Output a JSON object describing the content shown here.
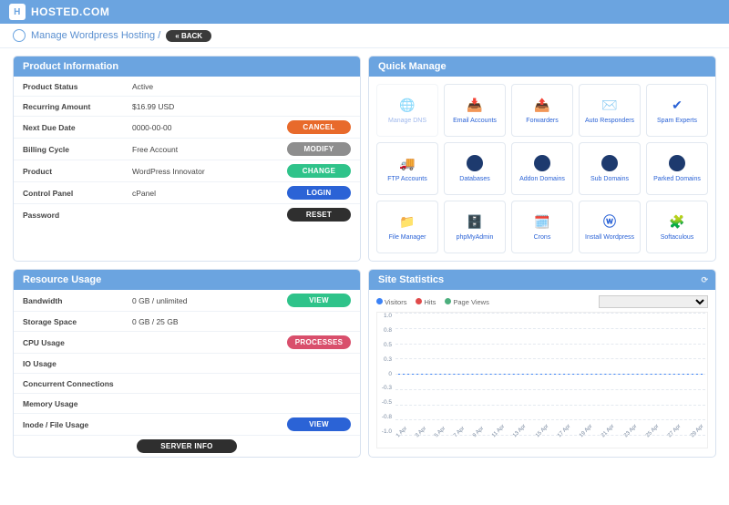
{
  "brand": "HOSTED.COM",
  "breadcrumb": "Manage Wordpress Hosting /",
  "back_label": "« BACK",
  "panels": {
    "product_info": {
      "title": "Product Information"
    },
    "quick_manage": {
      "title": "Quick Manage"
    },
    "resource_usage": {
      "title": "Resource Usage"
    },
    "site_stats": {
      "title": "Site Statistics"
    }
  },
  "rows": {
    "status_l": "Product Status",
    "status_v": "Active",
    "recur_l": "Recurring Amount",
    "recur_v": "$16.99 USD",
    "next_l": "Next Due Date",
    "next_v": "0000-00-00",
    "cycle_l": "Billing Cycle",
    "cycle_v": "Free Account",
    "product_l": "Product",
    "product_v": "WordPress Innovator",
    "cpanel_l": "Control Panel",
    "cpanel_v": "cPanel",
    "pass_l": "Password"
  },
  "btns": {
    "cancel": "CANCEL",
    "modify": "MODIFY",
    "change": "CHANGE",
    "login": "LOGIN",
    "reset": "RESET",
    "view": "VIEW",
    "processes": "PROCESSES",
    "server": "SERVER INFO"
  },
  "res": {
    "bw_l": "Bandwidth",
    "bw_v": "0 GB / unlimited",
    "sp_l": "Storage Space",
    "sp_v": "0 GB / 25 GB",
    "cpu_l": "CPU Usage",
    "io_l": "IO Usage",
    "cc_l": "Concurrent Connections",
    "mem_l": "Memory Usage",
    "inode_l": "Inode / File Usage"
  },
  "qm": {
    "dns": "Manage DNS",
    "email": "Email Accounts",
    "fwd": "Forwarders",
    "auto": "Auto Responders",
    "spam": "Spam Experts",
    "ftp": "FTP Accounts",
    "db": "Databases",
    "addon": "Addon Domains",
    "sub": "Sub Domains",
    "parked": "Parked Domains",
    "fm": "File Manager",
    "pma": "phpMyAdmin",
    "crons": "Crons",
    "wp": "Install Wordpress",
    "soft": "Softaculous"
  },
  "legend": {
    "visitors": "Visitors",
    "hits": "Hits",
    "pv": "Page Views"
  },
  "chart_data": {
    "type": "line",
    "title": "",
    "xlabel": "",
    "ylabel": "",
    "ylim": [
      -1.0,
      1.0
    ],
    "yticks": [
      "1.0",
      "0.8",
      "0.5",
      "0.3",
      "0",
      "-0.3",
      "-0.5",
      "-0.8",
      "-1.0"
    ],
    "categories": [
      "1 Apr",
      "3 Apr",
      "5 Apr",
      "7 Apr",
      "9 Apr",
      "11 Apr",
      "13 Apr",
      "15 Apr",
      "17 Apr",
      "19 Apr",
      "21 Apr",
      "23 Apr",
      "25 Apr",
      "27 Apr",
      "29 Apr"
    ],
    "series": [
      {
        "name": "Visitors",
        "color": "#3b82f6",
        "values": [
          0,
          0,
          0,
          0,
          0,
          0,
          0,
          0,
          0,
          0,
          0,
          0,
          0,
          0,
          0
        ]
      },
      {
        "name": "Hits",
        "color": "#e04a4a",
        "values": [
          0,
          0,
          0,
          0,
          0,
          0,
          0,
          0,
          0,
          0,
          0,
          0,
          0,
          0,
          0
        ]
      },
      {
        "name": "Page Views",
        "color": "#4caf7d",
        "values": [
          0,
          0,
          0,
          0,
          0,
          0,
          0,
          0,
          0,
          0,
          0,
          0,
          0,
          0,
          0
        ]
      }
    ]
  }
}
